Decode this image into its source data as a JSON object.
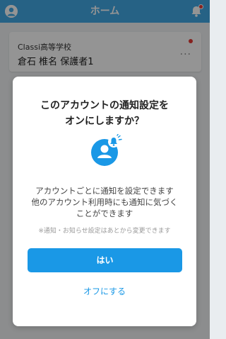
{
  "header": {
    "title": "ホーム",
    "left_icon": "account-icon",
    "right_icon": "bell-icon"
  },
  "card": {
    "school_name": "Classi高等学校",
    "user_name": "倉石 椎名 保護者1",
    "more_label": "···"
  },
  "dialog": {
    "title_line1": "このアカウントの通知設定を",
    "title_line2": "オンにしますか？",
    "icon": "notification-person-icon",
    "body_line1": "アカウントごとに通知を設定できます",
    "body_line2": "他のアカウント利用時にも通知に気づく",
    "body_line3": "ことができます",
    "note": "※通知・お知らせ設定はあとから変更できます",
    "yes_label": "はい",
    "off_label": "オフにする"
  },
  "colors": {
    "header_bg": "#42a9e6",
    "accent": "#1a98e6",
    "alert": "#e53935"
  }
}
